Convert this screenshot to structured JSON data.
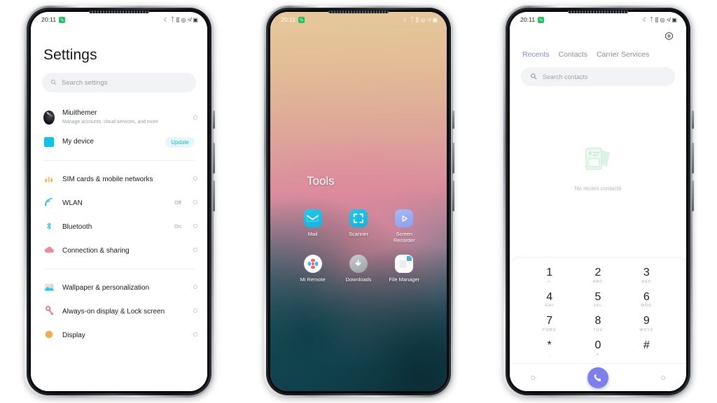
{
  "status_bar": {
    "time": "20:11",
    "badge_icon": "call-badge-icon",
    "icons": [
      "dnd-moon-icon",
      "bluetooth-icon",
      "vibrate-icon",
      "location-icon",
      "signal-icon",
      "battery-icon"
    ],
    "badge_color": "#20c560"
  },
  "phone1": {
    "title": "Settings",
    "search": {
      "placeholder": "Search settings",
      "icon": "search-icon"
    },
    "groups": [
      {
        "items": [
          {
            "label": "Miuithemer",
            "sub": "Manage accounts, cloud services, and more",
            "icon": "account-avatar",
            "value": "",
            "badge": ""
          },
          {
            "label": "My device",
            "sub": "",
            "icon": "device-icon",
            "value": "",
            "badge": "Update"
          }
        ]
      },
      {
        "items": [
          {
            "label": "SIM cards & mobile networks",
            "sub": "",
            "icon": "sim-signal-icon",
            "value": "",
            "badge": ""
          },
          {
            "label": "WLAN",
            "sub": "",
            "icon": "wifi-icon",
            "value": "Off",
            "badge": ""
          },
          {
            "label": "Bluetooth",
            "sub": "",
            "icon": "bluetooth-icon",
            "value": "On",
            "badge": ""
          },
          {
            "label": "Connection & sharing",
            "sub": "",
            "icon": "cloud-sharing-icon",
            "value": "",
            "badge": ""
          }
        ]
      },
      {
        "items": [
          {
            "label": "Wallpaper & personalization",
            "sub": "",
            "icon": "wallpaper-icon",
            "value": "",
            "badge": ""
          },
          {
            "label": "Always-on display & Lock screen",
            "sub": "",
            "icon": "lock-key-icon",
            "value": "",
            "badge": ""
          },
          {
            "label": "Display",
            "sub": "",
            "icon": "display-icon",
            "value": "",
            "badge": ""
          }
        ]
      }
    ]
  },
  "phone2": {
    "folder_title": "Tools",
    "apps": [
      {
        "name": "Mail",
        "icon": "mail-icon"
      },
      {
        "name": "Scanner",
        "icon": "scanner-icon"
      },
      {
        "name": "Screen Recorder",
        "icon": "screen-recorder-icon"
      },
      {
        "name": "Mi Remote",
        "icon": "mi-remote-icon"
      },
      {
        "name": "Downloads",
        "icon": "downloads-icon"
      },
      {
        "name": "File Manager",
        "icon": "file-manager-icon"
      }
    ]
  },
  "phone3": {
    "settings_icon": "gear-icon",
    "tabs": [
      {
        "label": "Recents",
        "active": true
      },
      {
        "label": "Contacts",
        "active": false
      },
      {
        "label": "Carrier Services",
        "active": false
      }
    ],
    "search": {
      "placeholder": "Search contacts",
      "icon": "search-icon"
    },
    "empty_state": {
      "text": "No recent contacts",
      "icon": "empty-contacts-illustration"
    },
    "keypad": [
      {
        "digit": "1",
        "sub": "∞"
      },
      {
        "digit": "2",
        "sub": "ABC"
      },
      {
        "digit": "3",
        "sub": "DEF"
      },
      {
        "digit": "4",
        "sub": "GHI"
      },
      {
        "digit": "5",
        "sub": "JKL"
      },
      {
        "digit": "6",
        "sub": "MNO"
      },
      {
        "digit": "7",
        "sub": "PQRS"
      },
      {
        "digit": "8",
        "sub": "TUV"
      },
      {
        "digit": "9",
        "sub": "WXYZ"
      },
      {
        "digit": "*",
        "sub": ","
      },
      {
        "digit": "0",
        "sub": "+"
      },
      {
        "digit": "#",
        "sub": ""
      }
    ],
    "call_button": {
      "icon": "phone-call-icon",
      "color": "#7d80ec"
    },
    "nav": {
      "left": "nav-dot-left",
      "right": "nav-dot-right"
    }
  }
}
